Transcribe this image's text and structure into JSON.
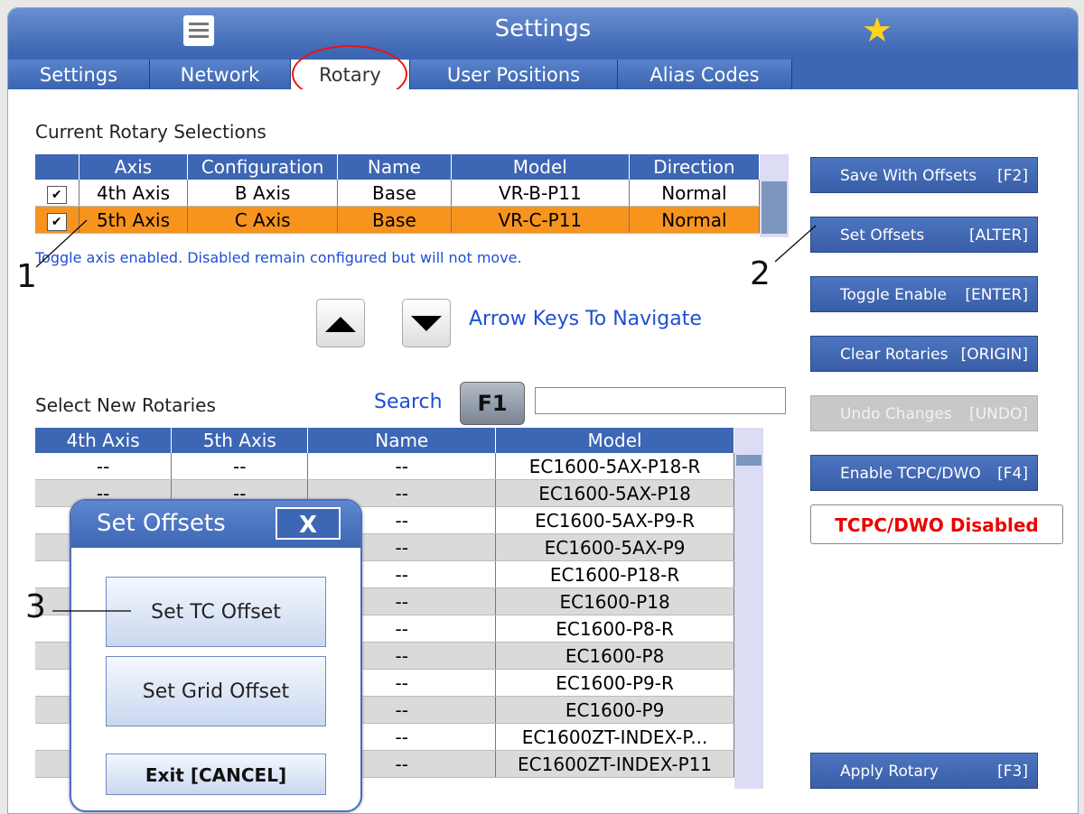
{
  "title": "Settings",
  "tabs": [
    "Settings",
    "Network",
    "Rotary",
    "User Positions",
    "Alias Codes"
  ],
  "active_tab": "Rotary",
  "current_section": {
    "heading": "Current Rotary Selections",
    "columns": [
      "",
      "Axis",
      "Configuration",
      "Name",
      "Model",
      "Direction"
    ],
    "rows": [
      {
        "checked": "✔",
        "axis": "4th Axis",
        "config": "B Axis",
        "name": "Base",
        "model": "VR-B-P11",
        "direction": "Normal"
      },
      {
        "checked": "✔",
        "axis": "5th Axis",
        "config": "C Axis",
        "name": "Base",
        "model": "VR-C-P11",
        "direction": "Normal"
      }
    ],
    "hint": "Toggle axis enabled. Disabled remain configured but will not move."
  },
  "nav": {
    "label": "Arrow Keys To Navigate"
  },
  "new_section": {
    "heading": "Select New Rotaries",
    "search_label": "Search",
    "search_key": "F1",
    "search_value": "",
    "columns": [
      "4th Axis",
      "5th Axis",
      "Name",
      "Model"
    ],
    "rows": [
      {
        "a4": "--",
        "a5": "--",
        "name": "--",
        "model": "EC1600-5AX-P18-R"
      },
      {
        "a4": "--",
        "a5": "--",
        "name": "--",
        "model": "EC1600-5AX-P18"
      },
      {
        "a4": "",
        "a5": "",
        "name": "--",
        "model": "EC1600-5AX-P9-R"
      },
      {
        "a4": "",
        "a5": "",
        "name": "--",
        "model": "EC1600-5AX-P9"
      },
      {
        "a4": "",
        "a5": "",
        "name": "--",
        "model": "EC1600-P18-R"
      },
      {
        "a4": "",
        "a5": "",
        "name": "--",
        "model": "EC1600-P18"
      },
      {
        "a4": "",
        "a5": "",
        "name": "--",
        "model": "EC1600-P8-R"
      },
      {
        "a4": "",
        "a5": "",
        "name": "--",
        "model": "EC1600-P8"
      },
      {
        "a4": "",
        "a5": "",
        "name": "--",
        "model": "EC1600-P9-R"
      },
      {
        "a4": "",
        "a5": "",
        "name": "--",
        "model": "EC1600-P9"
      },
      {
        "a4": "",
        "a5": "",
        "name": "--",
        "model": "EC1600ZT-INDEX-P..."
      },
      {
        "a4": "",
        "a5": "",
        "name": "--",
        "model": "EC1600ZT-INDEX-P11"
      }
    ]
  },
  "side_buttons": {
    "save": {
      "label": "Save With Offsets",
      "key": "[F2]"
    },
    "set_offsets": {
      "label": "Set Offsets",
      "key": "[ALTER]"
    },
    "toggle": {
      "label": "Toggle Enable",
      "key": "[ENTER]"
    },
    "clear": {
      "label": "Clear Rotaries",
      "key": "[ORIGIN]"
    },
    "undo": {
      "label": "Undo Changes",
      "key": "[UNDO]"
    },
    "tcpc": {
      "label": "Enable TCPC/DWO",
      "key": "[F4]"
    },
    "apply": {
      "label": "Apply Rotary",
      "key": "[F3]"
    }
  },
  "tcpc_status": "TCPC/DWO Disabled",
  "dialog": {
    "title": "Set Offsets",
    "close": "X",
    "btn_tc": "Set TC Offset",
    "btn_grid": "Set Grid Offset",
    "btn_exit": "Exit  [CANCEL]"
  },
  "callouts": {
    "c1": "1",
    "c2": "2",
    "c3": "3"
  },
  "colors": {
    "accent": "#3d66b4",
    "highlight_row": "#f7941d",
    "link": "#1f4fd1",
    "status_red": "#e00000",
    "star": "#ffd21e"
  }
}
